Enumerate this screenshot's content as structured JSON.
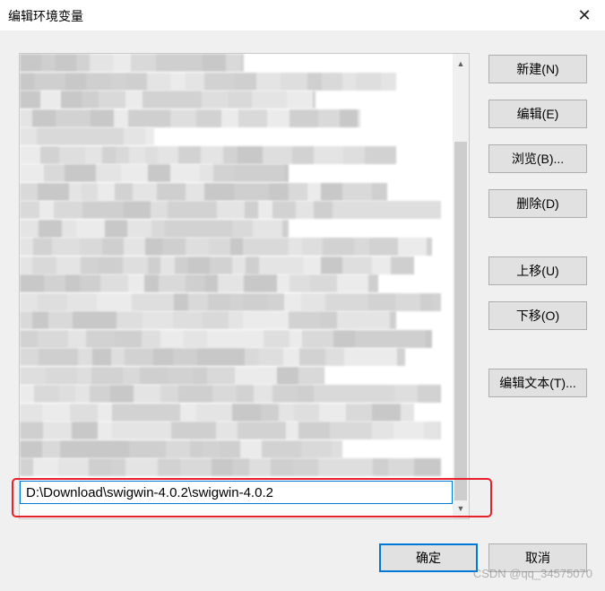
{
  "window": {
    "title": "编辑环境变量",
    "close_glyph": "✕"
  },
  "list": {
    "selected_value": "D:\\Download\\swigwin-4.0.2\\swigwin-4.0.2"
  },
  "buttons": {
    "new": "新建(N)",
    "edit": "编辑(E)",
    "browse": "浏览(B)...",
    "delete": "删除(D)",
    "move_up": "上移(U)",
    "move_down": "下移(O)",
    "edit_text": "编辑文本(T)...",
    "ok": "确定",
    "cancel": "取消"
  },
  "watermark": "CSDN @qq_34575070"
}
